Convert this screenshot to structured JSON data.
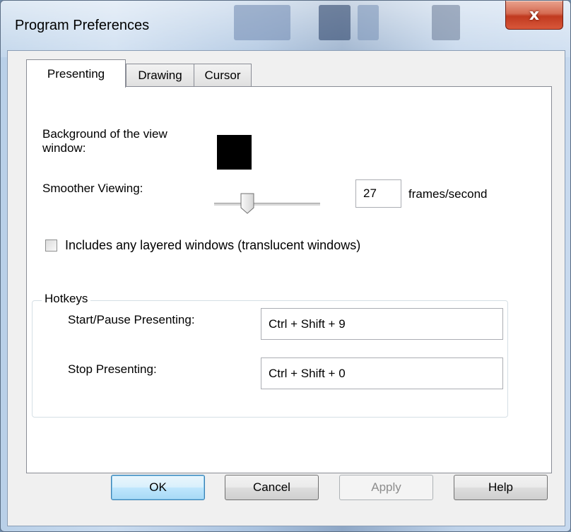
{
  "window": {
    "title": "Program Preferences",
    "close_glyph": "x"
  },
  "tabs": [
    {
      "label": "Presenting",
      "active": true
    },
    {
      "label": "Drawing",
      "active": false
    },
    {
      "label": "Cursor",
      "active": false
    }
  ],
  "presenting": {
    "background_label": "Background of the view window:",
    "background_color": "#000000",
    "smoother_label": "Smoother Viewing:",
    "fps_value": "27",
    "fps_unit": "frames/second",
    "layered_checkbox_label": "Includes any layered windows (translucent windows)",
    "layered_checked": false
  },
  "hotkeys": {
    "group_title": "Hotkeys",
    "start_label": "Start/Pause Presenting:",
    "start_value": "Ctrl + Shift + 9",
    "stop_label": "Stop Presenting:",
    "stop_value": "Ctrl + Shift + 0"
  },
  "buttons": {
    "ok": "OK",
    "cancel": "Cancel",
    "apply": "Apply",
    "help": "Help"
  }
}
